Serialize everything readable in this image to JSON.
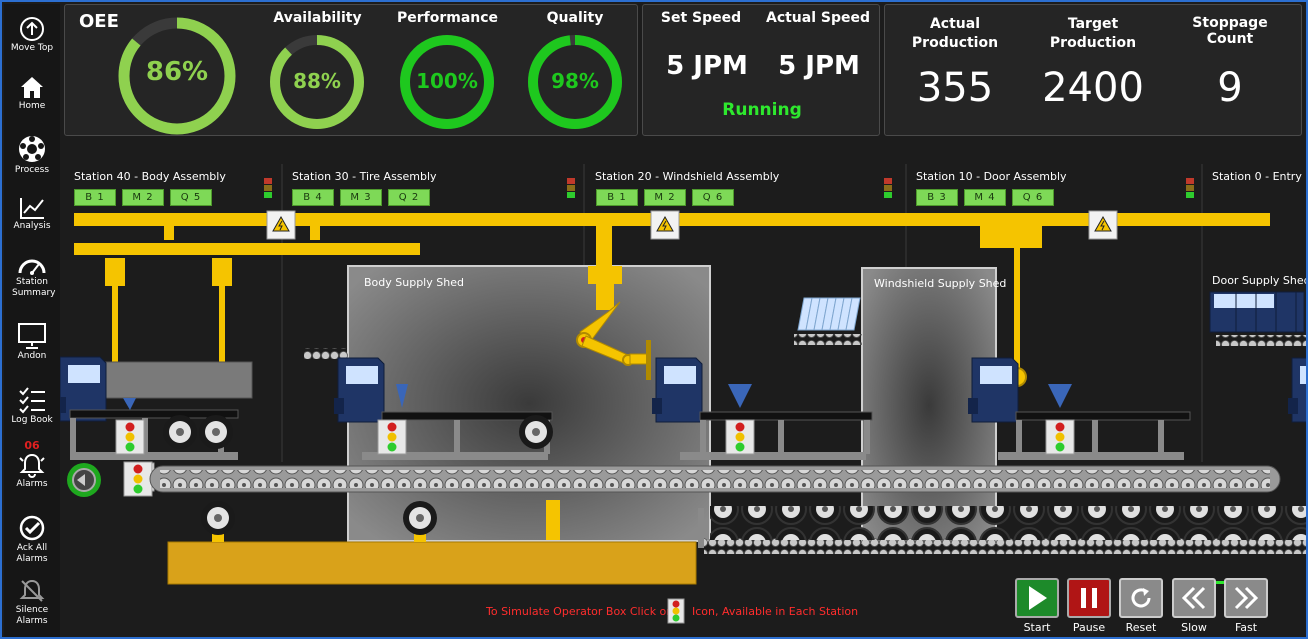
{
  "sidebar": {
    "items": [
      {
        "label": "Move Top",
        "icon": "arrow-up-circle-icon"
      },
      {
        "label": "Home",
        "icon": "home-icon"
      },
      {
        "label": "Process",
        "icon": "process-icon"
      },
      {
        "label": "Analysis",
        "icon": "line-chart-icon"
      },
      {
        "label": "Station Summary",
        "icon": "gauge-icon"
      },
      {
        "label": "Andon",
        "icon": "monitor-icon"
      },
      {
        "label": "Log Book",
        "icon": "checklist-icon"
      },
      {
        "label": "Alarms",
        "icon": "bell-icon",
        "count": "06"
      },
      {
        "label": "Ack All Alarms",
        "icon": "check-circle-icon"
      },
      {
        "label": "Silence Alarms",
        "icon": "bell-off-icon"
      }
    ]
  },
  "kpis": {
    "oee": {
      "title": "OEE",
      "value": "86%",
      "percent": 86
    },
    "availability": {
      "title": "Availability",
      "value": "88%",
      "percent": 88
    },
    "performance": {
      "title": "Performance",
      "value": "100%",
      "percent": 100
    },
    "quality": {
      "title": "Quality",
      "value": "98%",
      "percent": 98
    }
  },
  "speed": {
    "set_title": "Set Speed",
    "set_value": "5 JPM",
    "actual_title": "Actual Speed",
    "actual_value": "5 JPM",
    "status": "Running"
  },
  "production": {
    "actual_title": "Actual Production",
    "actual_value": "355",
    "target_title": "Target Production",
    "target_value": "2400",
    "stoppage_title": "Stoppage Count",
    "stoppage_value": "9"
  },
  "stations": [
    {
      "label": "Station 40 - Body Assembly",
      "tags": [
        "B 1",
        "M 2",
        "Q 5"
      ]
    },
    {
      "label": "Station 30 - Tire Assembly",
      "tags": [
        "B 4",
        "M 3",
        "Q 2"
      ]
    },
    {
      "label": "Station 20 - Windshield Assembly",
      "tags": [
        "B 1",
        "M 2",
        "Q 6"
      ]
    },
    {
      "label": "Station 10 - Door Assembly",
      "tags": [
        "B 3",
        "M 4",
        "Q 6"
      ]
    },
    {
      "label": "Station 0 - Entry",
      "tags": []
    }
  ],
  "sheds": {
    "body": "Body Supply Shed",
    "windshield": "Windshield Supply Shed",
    "door": "Door Supply Shed"
  },
  "hint": {
    "before": "To Simulate Operator Box Click on",
    "after": "Icon, Available in Each Station"
  },
  "controls": [
    {
      "label": "Start",
      "icon": "play-icon"
    },
    {
      "label": "Pause",
      "icon": "pause-icon"
    },
    {
      "label": "Reset",
      "icon": "reset-icon"
    },
    {
      "label": "Slow",
      "icon": "rewind-icon"
    },
    {
      "label": "Fast",
      "icon": "fast-forward-icon"
    }
  ],
  "colors": {
    "accent_green": "#2ee82e",
    "gauge_light_green": "#8fd14f",
    "gauge_green": "#1ec81e",
    "rail_yellow": "#f5c400",
    "truck_blue": "#1f3566",
    "start_button": "#1d8a2a",
    "pause_button": "#b01515"
  }
}
